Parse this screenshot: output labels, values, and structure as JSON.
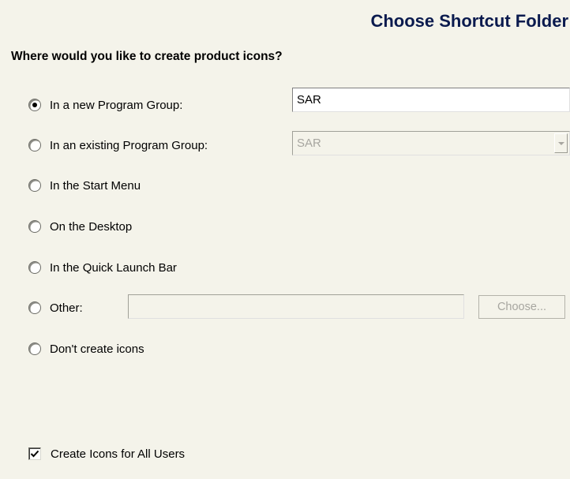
{
  "header": {
    "title": "Choose Shortcut Folder"
  },
  "question": "Where would you like to create product icons?",
  "options": [
    {
      "label": "In a new Program Group:",
      "selected": true
    },
    {
      "label": "In an existing Program Group:",
      "selected": false
    },
    {
      "label": "In the Start Menu",
      "selected": false
    },
    {
      "label": "On the Desktop",
      "selected": false
    },
    {
      "label": "In the Quick Launch Bar",
      "selected": false
    },
    {
      "label": "Other:",
      "selected": false
    },
    {
      "label": "Don't create icons",
      "selected": false
    }
  ],
  "new_group_input": {
    "value": "SAR"
  },
  "existing_group_select": {
    "value": "SAR",
    "icon": "chevron-down-icon"
  },
  "other_input": {
    "value": ""
  },
  "choose_button": {
    "label": "Choose..."
  },
  "all_users_checkbox": {
    "label": "Create Icons for All Users",
    "checked": true,
    "icon": "checkmark-icon"
  },
  "colors": {
    "background": "#f4f3ea",
    "title": "#0a1a4e",
    "disabled_text": "#a7a6a0"
  }
}
